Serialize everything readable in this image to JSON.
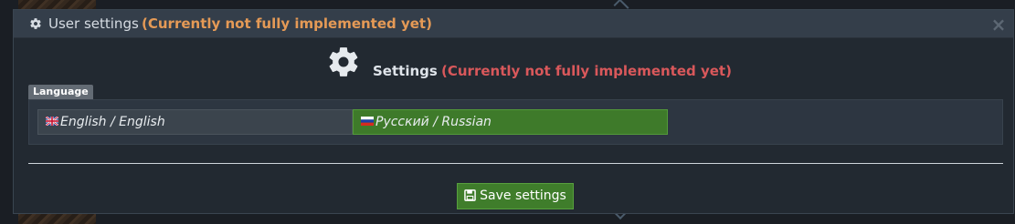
{
  "dialog": {
    "title": "User settings",
    "title_notice": "(Currently not fully implemented yet)",
    "close_glyph": "×",
    "title_icon": "gear-icon"
  },
  "settings": {
    "heading": "Settings",
    "heading_notice": "(Currently not fully implemented yet)",
    "heading_icon": "gear-icon",
    "section_label": "Language",
    "languages": [
      {
        "label": "English / English",
        "flag": "uk-flag-icon",
        "selected": false
      },
      {
        "label": "Русский / Russian",
        "flag": "russia-flag-icon",
        "selected": true
      }
    ]
  },
  "actions": {
    "save_label": "Save settings",
    "save_icon": "floppy-disk-icon"
  },
  "colors": {
    "notice_title": "#e59a56",
    "notice_heading": "#d9585b",
    "selected_green": "#3e7a2a",
    "panel_bg": "#222931"
  }
}
